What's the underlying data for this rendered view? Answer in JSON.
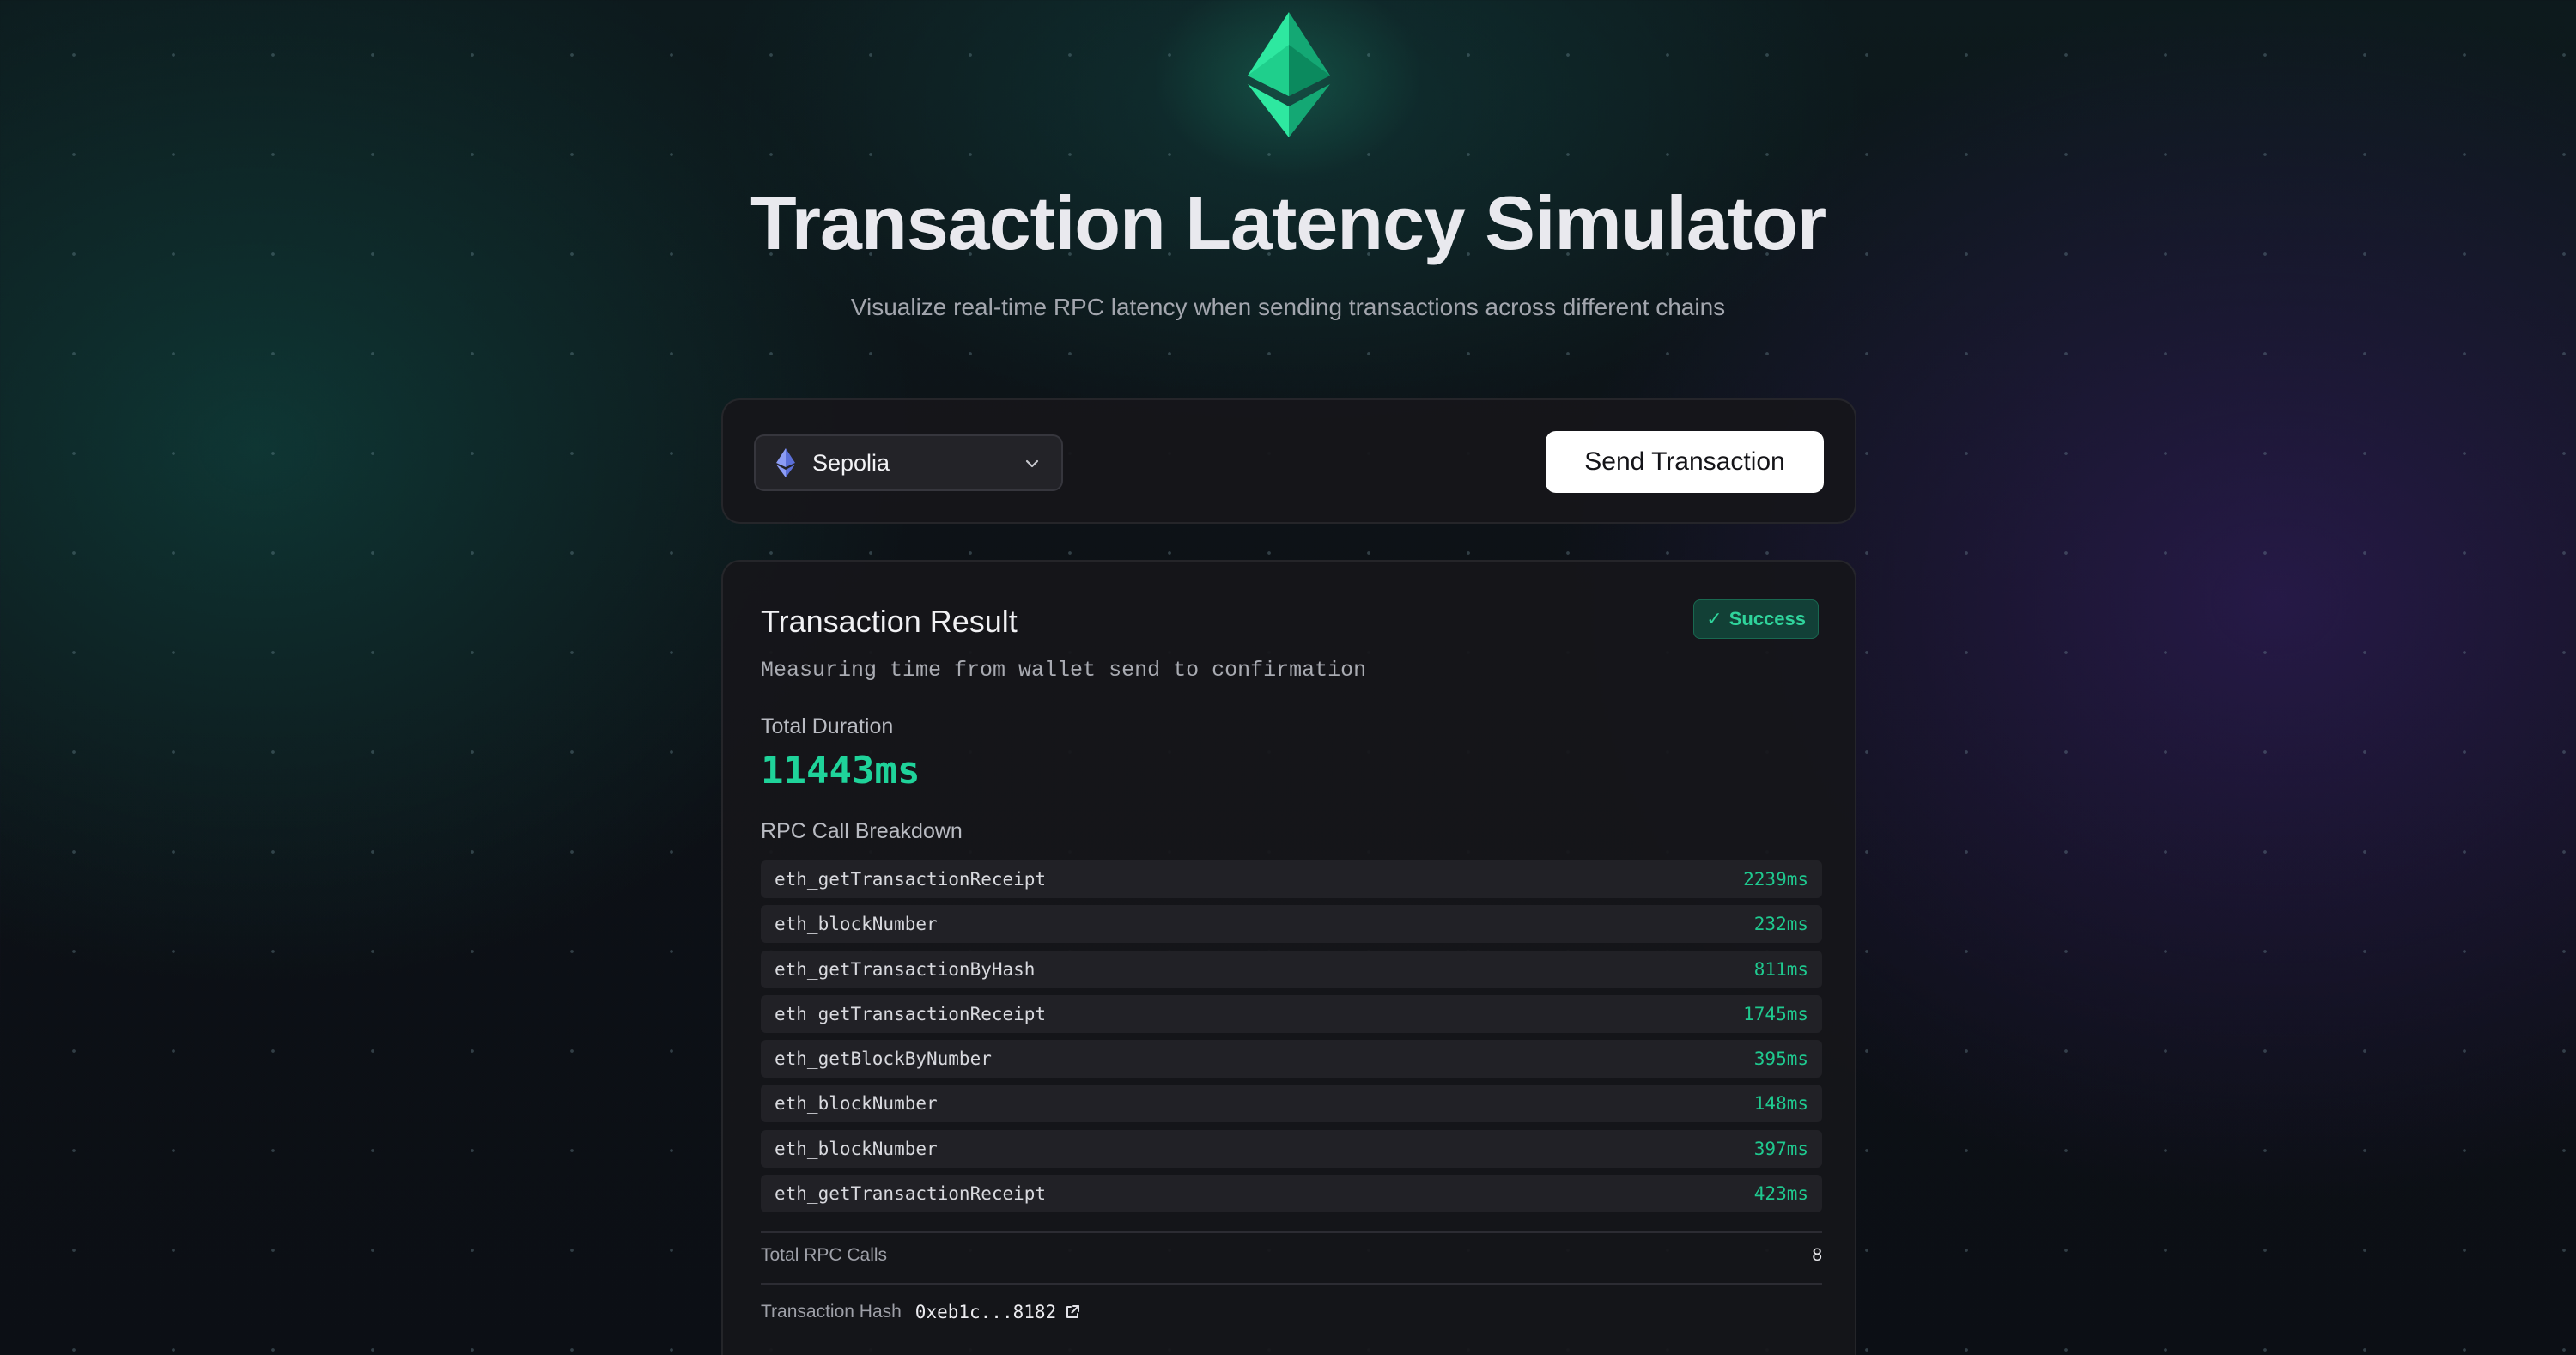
{
  "header": {
    "logo_icon": "ethereum-logo-icon",
    "title": "Transaction Latency Simulator",
    "subtitle": "Visualize real-time RPC latency when sending transactions across different chains"
  },
  "toolbar": {
    "chain_select": {
      "icon": "ethereum-icon",
      "value": "Sepolia",
      "chevron_icon": "chevron-down-icon"
    },
    "send_label": "Send Transaction"
  },
  "result": {
    "title": "Transaction Result",
    "status": {
      "icon": "check-icon",
      "check": "✓",
      "label": "Success",
      "color": "#2fd39b"
    },
    "description": "Measuring time from wallet send to confirmation",
    "total_duration_label": "Total Duration",
    "total_duration_value": "11443ms",
    "breakdown_label": "RPC Call Breakdown",
    "rpc_calls": [
      {
        "method": "eth_getTransactionReceipt",
        "duration": "2239ms"
      },
      {
        "method": "eth_blockNumber",
        "duration": "232ms"
      },
      {
        "method": "eth_getTransactionByHash",
        "duration": "811ms"
      },
      {
        "method": "eth_getTransactionReceipt",
        "duration": "1745ms"
      },
      {
        "method": "eth_getBlockByNumber",
        "duration": "395ms"
      },
      {
        "method": "eth_blockNumber",
        "duration": "148ms"
      },
      {
        "method": "eth_blockNumber",
        "duration": "397ms"
      },
      {
        "method": "eth_getTransactionReceipt",
        "duration": "423ms"
      }
    ],
    "total_rpc_calls_label": "Total RPC Calls",
    "total_rpc_calls_value": "8",
    "tx_hash_label": "Transaction Hash",
    "tx_hash_value": "0xeb1c...8182",
    "external_link_icon": "external-link-icon"
  },
  "colors": {
    "accent_green": "#1fd39a",
    "button_bg": "#ffffff"
  }
}
